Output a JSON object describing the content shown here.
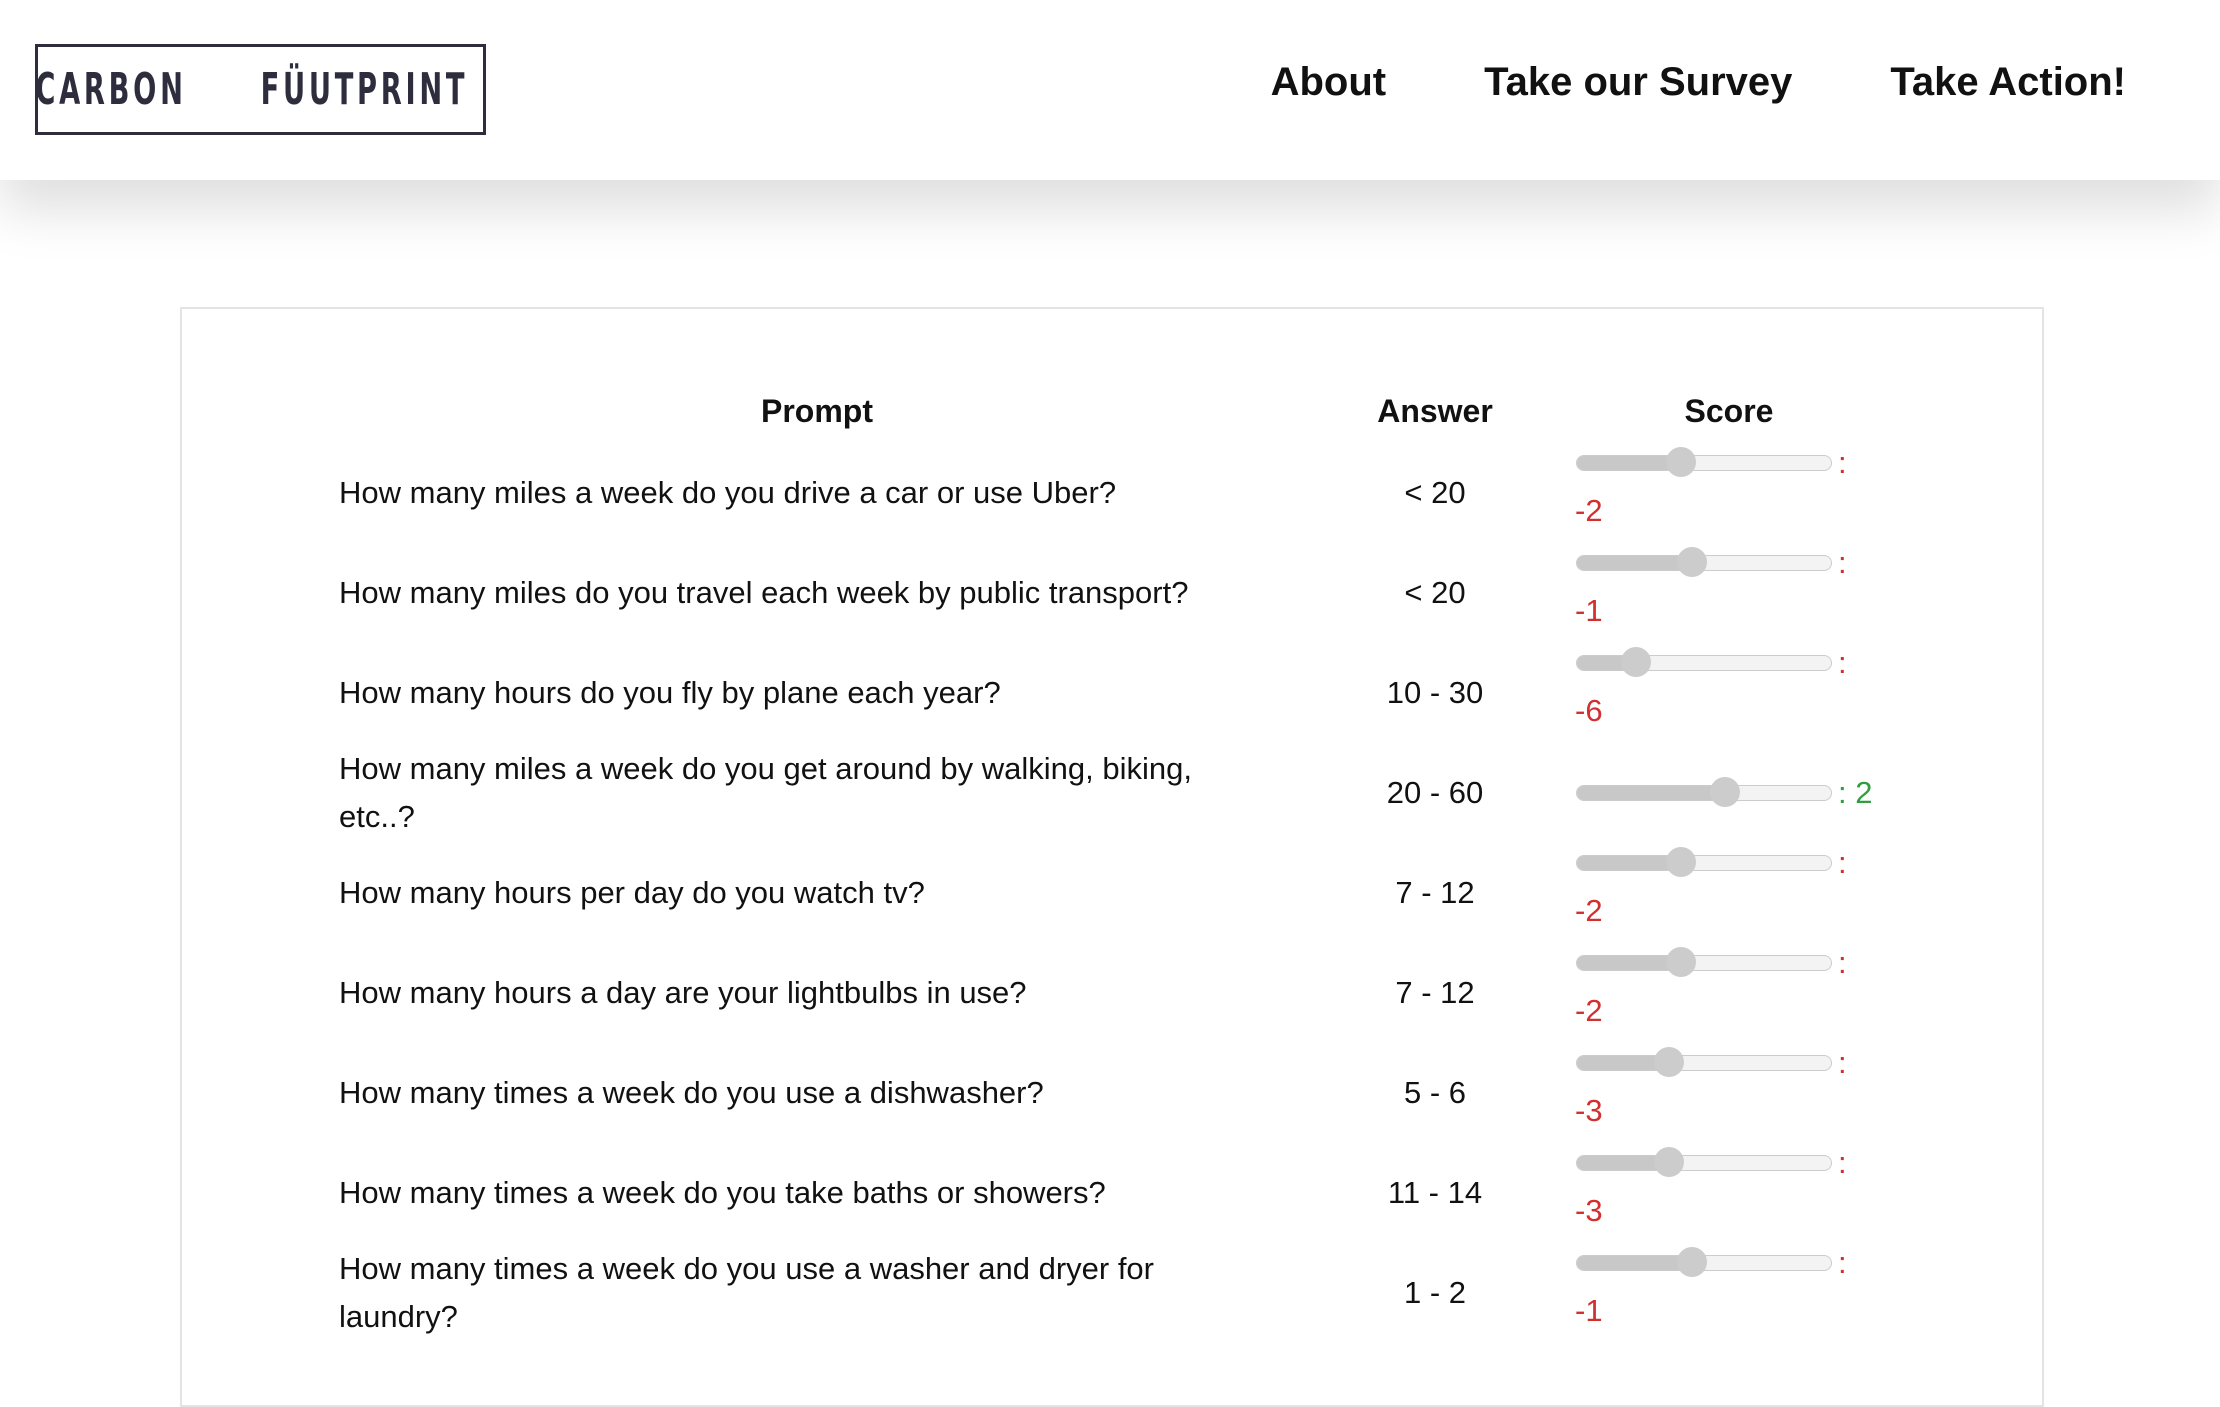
{
  "header": {
    "logo": {
      "left_word": "CARBON",
      "right_word": "FÜUTPRINT",
      "icon": "footprint-icon"
    },
    "nav": [
      "About",
      "Take our Survey",
      "Take Action!"
    ]
  },
  "table": {
    "columns": [
      "Prompt",
      "Answer",
      "Score"
    ],
    "slider_range": [
      -10,
      10
    ],
    "rows": [
      {
        "prompt": "How many miles a week do you drive a car or use Uber?",
        "answer": "< 20",
        "score": -2
      },
      {
        "prompt": "How many miles do you travel each week by public transport?",
        "answer": "< 20",
        "score": -1
      },
      {
        "prompt": "How many hours do you fly by plane each year?",
        "answer": "10 - 30",
        "score": -6
      },
      {
        "prompt": "How many miles a week do you get around by walking, biking, etc..?",
        "answer": "20 - 60",
        "score": 2
      },
      {
        "prompt": "How many hours per day do you watch tv?",
        "answer": "7 - 12",
        "score": -2
      },
      {
        "prompt": "How many hours a day are your lightbulbs in use?",
        "answer": "7 - 12",
        "score": -2
      },
      {
        "prompt": "How many times a week do you use a dishwasher?",
        "answer": "5 - 6",
        "score": -3
      },
      {
        "prompt": "How many times a week do you take baths or showers?",
        "answer": "11 - 14",
        "score": -3
      },
      {
        "prompt": "How many times a week do you use a washer and dryer for laundry?",
        "answer": "1 - 2",
        "score": -1
      }
    ]
  },
  "colors": {
    "negative": "#d32f2f",
    "positive": "#2e9e3e",
    "text": "#111111",
    "logo": "#2d2d3d"
  }
}
